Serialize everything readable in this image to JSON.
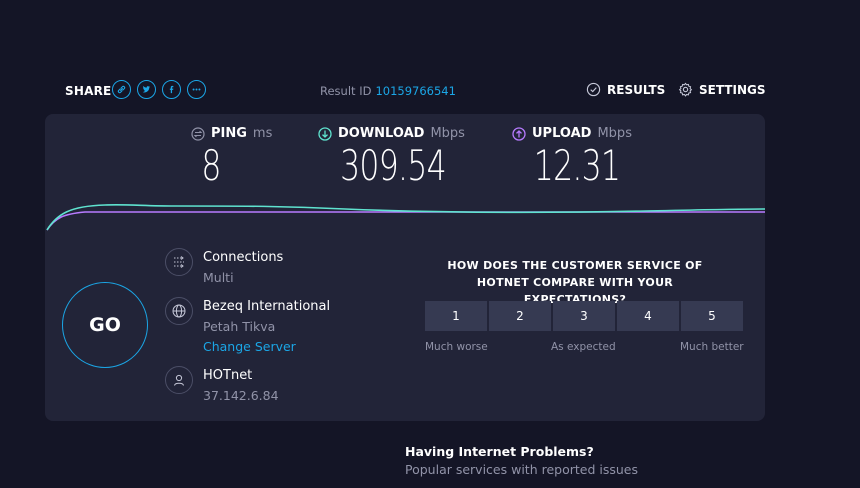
{
  "header": {
    "share_label": "SHARE",
    "share_icons": [
      "link-icon",
      "twitter-icon",
      "facebook-icon",
      "more-icon"
    ],
    "result_id_label": "Result ID",
    "result_id_value": "10159766541",
    "results_label": "RESULTS",
    "settings_label": "SETTINGS"
  },
  "metrics": {
    "ping": {
      "label": "PING",
      "unit": "ms",
      "value": "8"
    },
    "download": {
      "label": "DOWNLOAD",
      "unit": "Mbps",
      "value": "309.54"
    },
    "upload": {
      "label": "UPLOAD",
      "unit": "Mbps",
      "value": "12.31"
    }
  },
  "go_label": "GO",
  "connection": {
    "connections_label": "Connections",
    "connections_value": "Multi",
    "server_name": "Bezeq International",
    "server_location": "Petah Tikva",
    "change_server": "Change Server",
    "isp_name": "HOTnet",
    "ip": "37.142.6.84"
  },
  "survey": {
    "question": "HOW DOES THE CUSTOMER SERVICE OF HOTNET COMPARE WITH YOUR EXPECTATIONS?",
    "options": [
      "1",
      "2",
      "3",
      "4",
      "5"
    ],
    "low_label": "Much worse",
    "mid_label": "As expected",
    "high_label": "Much better"
  },
  "problems": {
    "title": "Having Internet Problems?",
    "subtitle": "Popular services with reported issues"
  },
  "colors": {
    "accent": "#1ba6e6",
    "download": "#5fe3cf",
    "upload": "#b77bff",
    "panel": "#222438",
    "background": "#141526"
  }
}
